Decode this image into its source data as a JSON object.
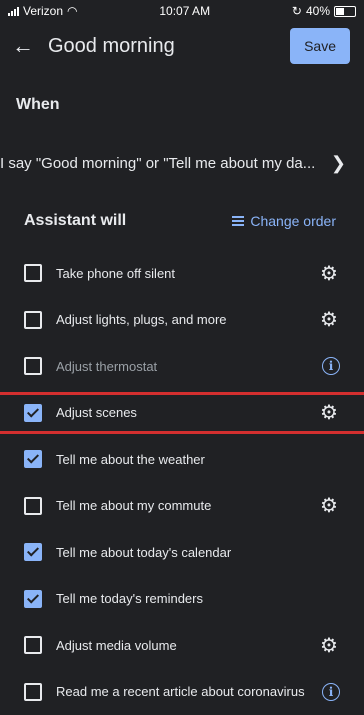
{
  "status": {
    "carrier": "Verizon",
    "time": "10:07 AM",
    "battery": "40%"
  },
  "header": {
    "title": "Good morning",
    "save_label": "Save"
  },
  "when": {
    "heading": "When",
    "trigger_text": "I say \"Good morning\" or \"Tell me about my da..."
  },
  "assistant": {
    "heading": "Assistant will",
    "change_order_label": "Change order"
  },
  "actions": [
    {
      "label": "Take phone off silent",
      "checked": false,
      "icon": "gear-icon"
    },
    {
      "label": "Adjust lights, plugs, and more",
      "checked": false,
      "icon": "gear-icon"
    },
    {
      "label": "Adjust thermostat",
      "checked": false,
      "icon": "info-icon",
      "dimmed": true
    },
    {
      "label": "Adjust scenes",
      "checked": true,
      "icon": "gear-icon",
      "highlighted": true
    },
    {
      "label": "Tell me about the weather",
      "checked": true,
      "icon": ""
    },
    {
      "label": "Tell me about my commute",
      "checked": false,
      "icon": "gear-icon"
    },
    {
      "label": "Tell me about today's calendar",
      "checked": true,
      "icon": ""
    },
    {
      "label": "Tell me today's reminders",
      "checked": true,
      "icon": ""
    },
    {
      "label": "Adjust media volume",
      "checked": false,
      "icon": "gear-icon"
    },
    {
      "label": "Read me a recent article about coronavirus",
      "checked": false,
      "icon": "info-icon"
    }
  ],
  "colors": {
    "accent": "#8ab4f8",
    "highlight": "#d32f2f",
    "background": "#202124"
  }
}
